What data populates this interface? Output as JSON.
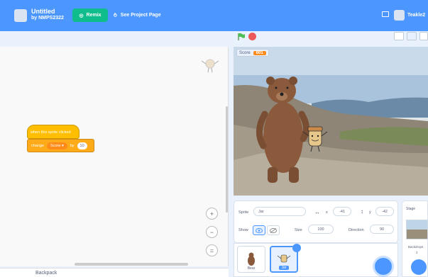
{
  "menu": {
    "project_title": "Untitled",
    "project_author": "by NMPS2322",
    "remix_label": "Remix",
    "see_project_label": "See Project Page",
    "username": "Teakle2"
  },
  "code": {
    "hat_block_text": "when this sprite clicked",
    "change_prefix": "change",
    "change_variable": "Score ▾",
    "change_by": "by",
    "change_value": "10",
    "zoom_in": "+",
    "zoom_out": "−",
    "zoom_reset": "=",
    "backpack_label": "Backpack"
  },
  "stage": {
    "monitor_label": "Score",
    "monitor_value": "601"
  },
  "sprite_info": {
    "sprite_label": "Sprite",
    "sprite_name": "Jar",
    "x_label": "x",
    "x_value": "-41",
    "y_label": "y",
    "y_value": "-42",
    "show_label": "Show",
    "size_label": "Size",
    "size_value": "100",
    "direction_label": "Direction",
    "direction_value": "90"
  },
  "sprites": [
    {
      "name": "Bear",
      "selected": false
    },
    {
      "name": "Jar",
      "selected": true
    }
  ],
  "stage_panel": {
    "title": "Stage",
    "backdrops_label": "Backdrops",
    "backdrop_count": "2"
  },
  "colors": {
    "menu_bar": "#4c97ff",
    "remix": "#0fbd8c",
    "events_block": "#ffbf00",
    "variables_block": "#ffab19",
    "score_monitor": "#ff8c1a"
  }
}
